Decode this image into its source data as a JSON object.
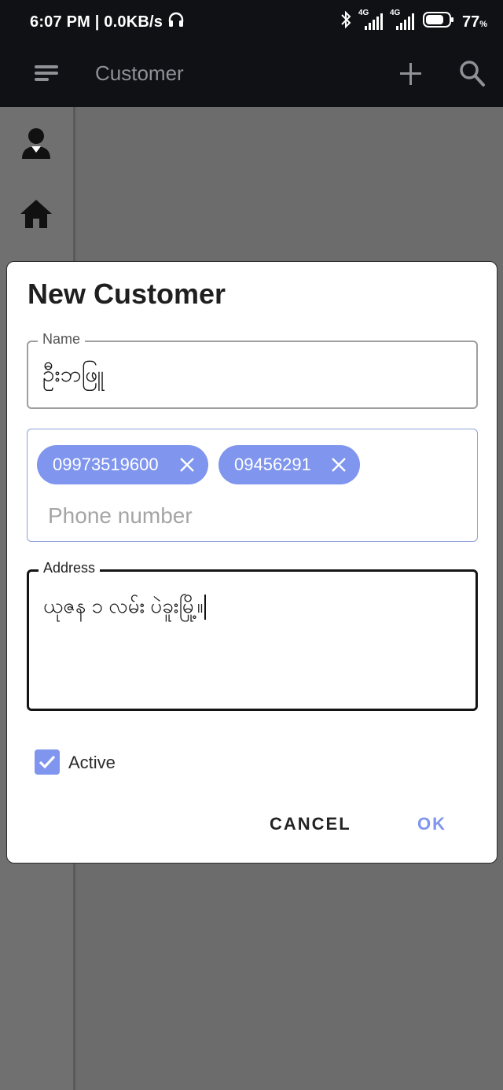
{
  "status_bar": {
    "time_speed": "6:07 PM | 0.0KB/s",
    "sim1": "4G",
    "sim2": "4G",
    "battery": "77",
    "battery_unit": "%"
  },
  "appbar": {
    "title": "Customer",
    "menu_icon": "menu-icon",
    "add_icon": "plus-icon",
    "search_icon": "search-icon"
  },
  "rail": {
    "items": [
      {
        "icon": "user-icon"
      },
      {
        "icon": "home-icon"
      }
    ]
  },
  "dialog": {
    "title": "New Customer",
    "name": {
      "label": "Name",
      "value": "ဦးဘဖြူ"
    },
    "phone": {
      "chips": [
        "09973519600",
        "09456291"
      ],
      "placeholder": "Phone number"
    },
    "address": {
      "label": "Address",
      "value": "ယုဇန ၁ လမ်း ပဲခူးမြို့။"
    },
    "active": {
      "label": "Active",
      "checked": true
    },
    "cancel_label": "CANCEL",
    "ok_label": "OK"
  },
  "colors": {
    "accent": "#7f95ee",
    "appbar_bg": "#0f1114",
    "scrim": "#6b6b6b"
  }
}
